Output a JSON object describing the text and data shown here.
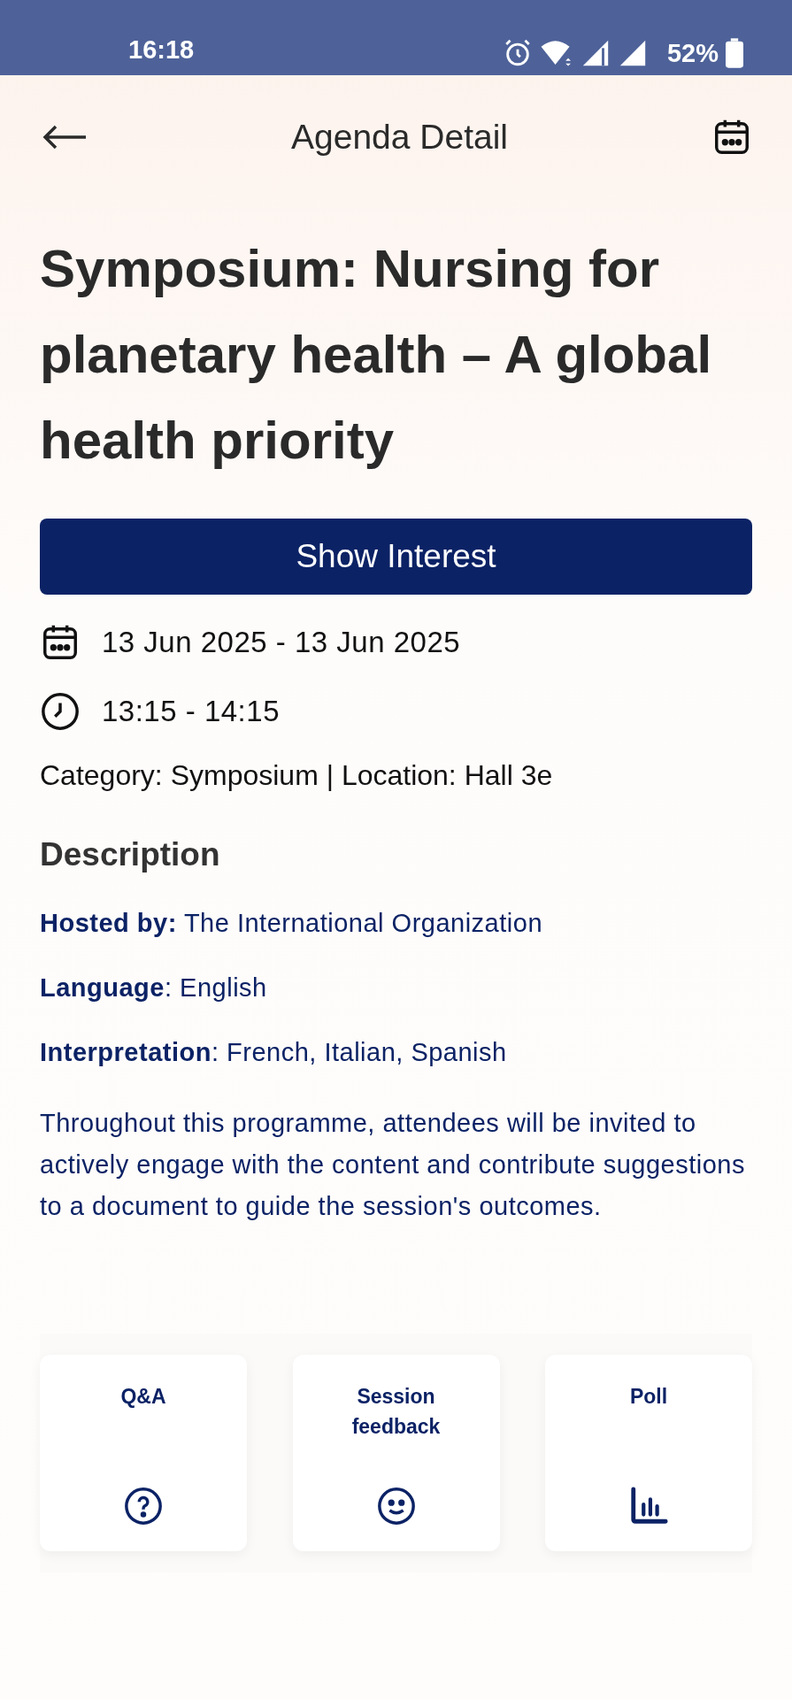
{
  "status_bar": {
    "time": "16:18",
    "battery": "52%"
  },
  "header": {
    "title": "Agenda Detail"
  },
  "event": {
    "title": "Symposium: Nursing for planetary health – A global health priority",
    "button": "Show Interest",
    "date": "13 Jun 2025 - 13 Jun 2025",
    "time": "13:15 - 14:15",
    "meta": "Category: Symposium | Location: Hall 3e"
  },
  "description": {
    "heading": "Description",
    "lines": [
      "**Hosted by:** The International Organization",
      "**Language**: English",
      "**Interpretation**: French, Italian, Spanish"
    ],
    "paragraph": "Throughout this programme, attendees will be invited to actively engage with the content and contribute suggestions to a document to guide the session's outcomes."
  },
  "actions": [
    {
      "label": "Q&A",
      "kind": "qa"
    },
    {
      "label": "Session feedback",
      "kind": "feedback"
    },
    {
      "label": "Poll",
      "kind": "poll"
    }
  ]
}
